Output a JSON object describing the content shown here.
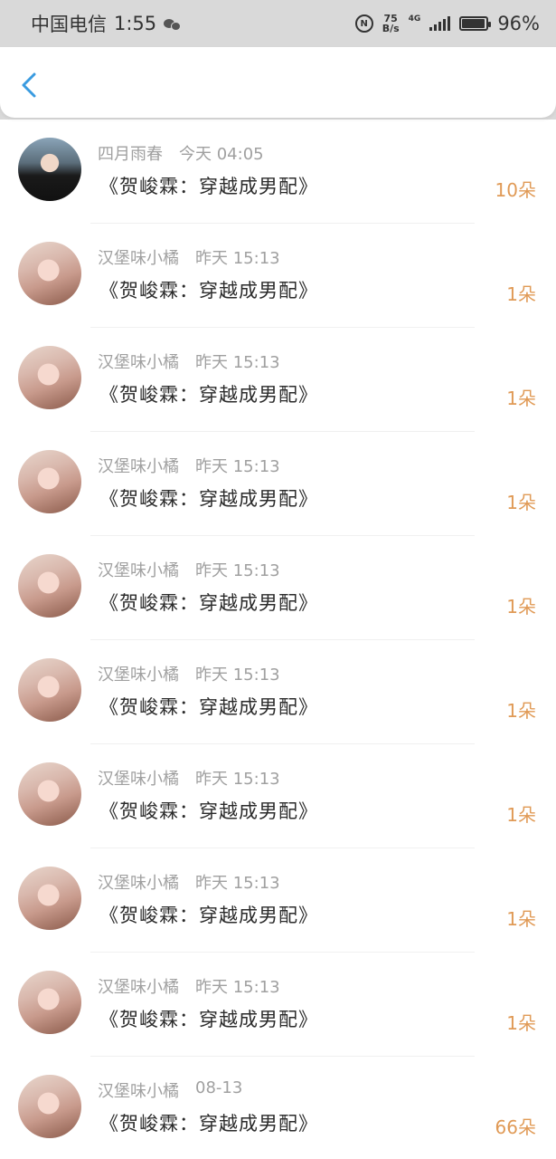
{
  "status_bar": {
    "carrier": "中国电信",
    "time": "1:55",
    "speed_value": "75",
    "speed_unit": "B/s",
    "network": "4G",
    "battery_percent": "96%",
    "battery_level": 0.96
  },
  "nav": {
    "back_icon": "chevron-left-icon",
    "accent": "#3a9be0"
  },
  "list": {
    "count_color": "#e09a56",
    "items": [
      {
        "name": "四月雨春",
        "time": "今天 04:05",
        "title": "《贺峻霖：穿越成男配》",
        "count": "10朵"
      },
      {
        "name": "汉堡味小橘",
        "time": "昨天 15:13",
        "title": "《贺峻霖：穿越成男配》",
        "count": "1朵"
      },
      {
        "name": "汉堡味小橘",
        "time": "昨天 15:13",
        "title": "《贺峻霖：穿越成男配》",
        "count": "1朵"
      },
      {
        "name": "汉堡味小橘",
        "time": "昨天 15:13",
        "title": "《贺峻霖：穿越成男配》",
        "count": "1朵"
      },
      {
        "name": "汉堡味小橘",
        "time": "昨天 15:13",
        "title": "《贺峻霖：穿越成男配》",
        "count": "1朵"
      },
      {
        "name": "汉堡味小橘",
        "time": "昨天 15:13",
        "title": "《贺峻霖：穿越成男配》",
        "count": "1朵"
      },
      {
        "name": "汉堡味小橘",
        "time": "昨天 15:13",
        "title": "《贺峻霖：穿越成男配》",
        "count": "1朵"
      },
      {
        "name": "汉堡味小橘",
        "time": "昨天 15:13",
        "title": "《贺峻霖：穿越成男配》",
        "count": "1朵"
      },
      {
        "name": "汉堡味小橘",
        "time": "昨天 15:13",
        "title": "《贺峻霖：穿越成男配》",
        "count": "1朵"
      },
      {
        "name": "汉堡味小橘",
        "time": "08-13",
        "title": "《贺峻霖：穿越成男配》",
        "count": "66朵"
      }
    ]
  }
}
